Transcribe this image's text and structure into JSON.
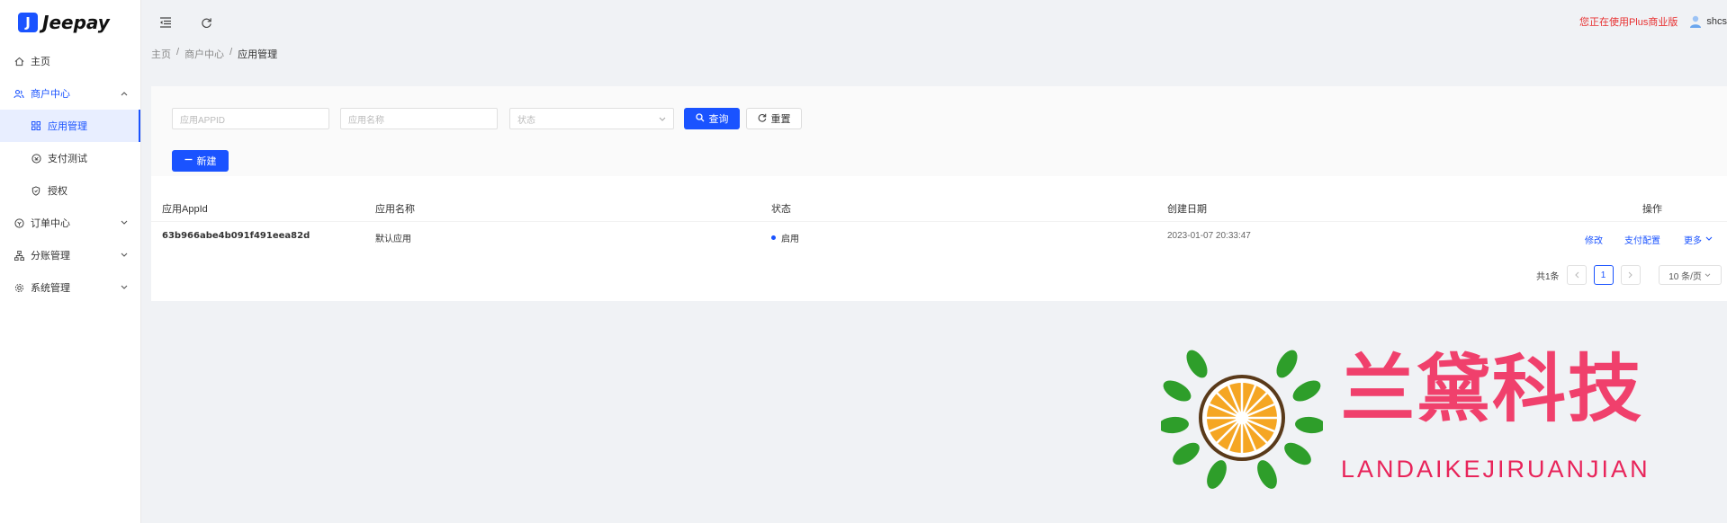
{
  "app": {
    "logo_letter": "J",
    "logo_text": "Jeepay"
  },
  "sidebar": {
    "items": [
      {
        "label": "主页",
        "icon": "home-icon"
      },
      {
        "label": "商户中心",
        "icon": "users-icon"
      },
      {
        "label": "应用管理",
        "icon": "grid-icon"
      },
      {
        "label": "支付测试",
        "icon": "pay-icon"
      },
      {
        "label": "授权",
        "icon": "shield-icon"
      },
      {
        "label": "订单中心",
        "icon": "order-icon"
      },
      {
        "label": "分账管理",
        "icon": "tree-icon"
      },
      {
        "label": "系统管理",
        "icon": "gear-icon"
      }
    ]
  },
  "header": {
    "edition": "您正在使用Plus商业版",
    "username": "shcs"
  },
  "breadcrumb": [
    "主页",
    "商户中心",
    "应用管理"
  ],
  "filters": {
    "appid_placeholder": "应用APPID",
    "name_placeholder": "应用名称",
    "state_placeholder": "状态",
    "search_label": "查询",
    "reset_label": "重置",
    "add_label": "新建"
  },
  "table": {
    "columns": [
      "应用AppId",
      "应用名称",
      "状态",
      "创建日期",
      "操作"
    ],
    "rows": [
      {
        "appid": "63b966abe4b091f491eea82d",
        "name": "默认应用",
        "state": "启用",
        "created": "2023-01-07 20:33:47",
        "actions": [
          "修改",
          "支付配置",
          "更多"
        ]
      }
    ]
  },
  "pagination": {
    "total_label": "共1条",
    "current": "1",
    "size_label": "10 条/页"
  },
  "watermark": {
    "title": "兰黛科技",
    "subtitle": "LANDAIKEJIRUANJIAN"
  },
  "colors": {
    "primary": "#1a53ff",
    "edition": "#e83030",
    "watermark": "#f0406c"
  }
}
